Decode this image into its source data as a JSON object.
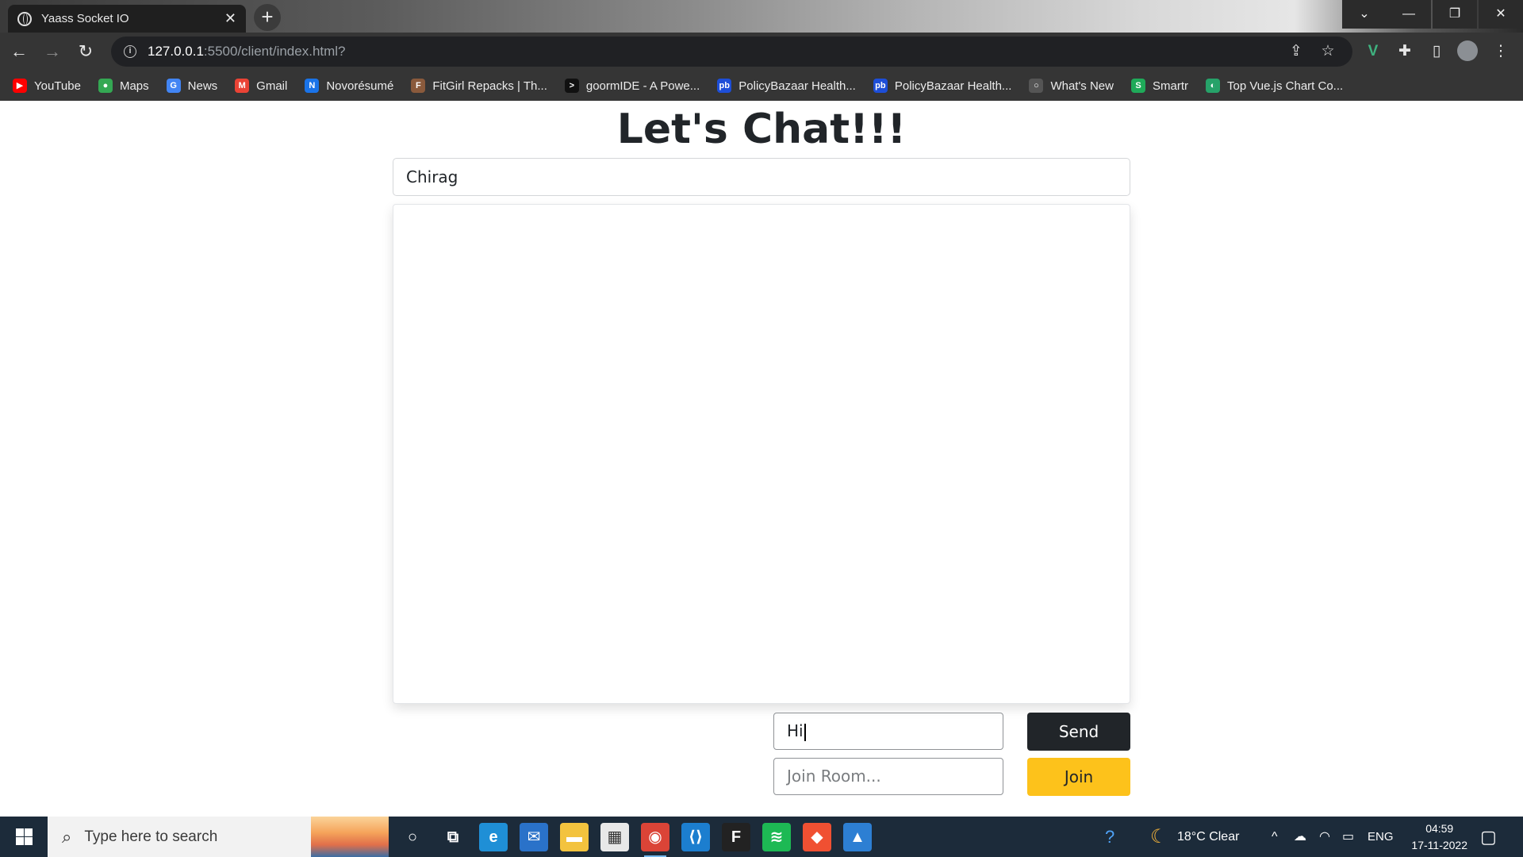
{
  "browser": {
    "tab_title": "Yaass Socket IO",
    "tab_close": "✕",
    "new_tab": "+",
    "url_host": "127.0.0.1",
    "url_path": ":5500/client/index.html?",
    "window_controls": [
      "⌄",
      "—",
      "❐",
      "✕"
    ],
    "bookmarks": [
      {
        "label": "YouTube",
        "icon": "youtube-icon",
        "color": "#ff0000",
        "glyph": "▶"
      },
      {
        "label": "Maps",
        "icon": "maps-pin-icon",
        "color": "#34a853",
        "glyph": "●"
      },
      {
        "label": "News",
        "icon": "google-news-icon",
        "color": "#4285f4",
        "glyph": "G"
      },
      {
        "label": "Gmail",
        "icon": "gmail-icon",
        "color": "#ea4335",
        "glyph": "M"
      },
      {
        "label": "Novorésumé",
        "icon": "novoresume-icon",
        "color": "#1a73e8",
        "glyph": "N"
      },
      {
        "label": "FitGirl Repacks | Th...",
        "icon": "fitgirl-icon",
        "color": "#8a5a3c",
        "glyph": "F"
      },
      {
        "label": "goormIDE - A Powe...",
        "icon": "terminal-icon",
        "color": "#111111",
        "glyph": ">"
      },
      {
        "label": "PolicyBazaar Health...",
        "icon": "policybazaar-icon",
        "color": "#1d4ed8",
        "glyph": "pb"
      },
      {
        "label": "PolicyBazaar Health...",
        "icon": "policybazaar-icon",
        "color": "#1d4ed8",
        "glyph": "pb"
      },
      {
        "label": "What's New",
        "icon": "whats-new-icon",
        "color": "#555555",
        "glyph": "○"
      },
      {
        "label": "Smartr",
        "icon": "smartr-icon",
        "color": "#1faa59",
        "glyph": "S"
      },
      {
        "label": "Top Vue.js Chart Co...",
        "icon": "vue-chart-icon",
        "color": "#26a269",
        "glyph": "◐"
      }
    ]
  },
  "page": {
    "title": "Let's Chat!!!",
    "name_value": "Chirag",
    "message_value": "Hi",
    "room_placeholder": "Join Room...",
    "send_label": "Send",
    "join_label": "Join",
    "colors": {
      "send": "#212529",
      "join": "#fdc21b"
    }
  },
  "taskbar": {
    "search_placeholder": "Type here to search",
    "apps": [
      "cortana-icon",
      "task-view-icon",
      "edge-icon",
      "mail-icon",
      "file-explorer-icon",
      "microsoft-store-icon",
      "chrome-icon",
      "vscode-icon",
      "figma-icon",
      "spotify-icon",
      "git-icon",
      "photos-icon"
    ],
    "weather": "18°C  Clear",
    "language": "ENG",
    "time": "04:59",
    "date": "17-11-2022"
  }
}
